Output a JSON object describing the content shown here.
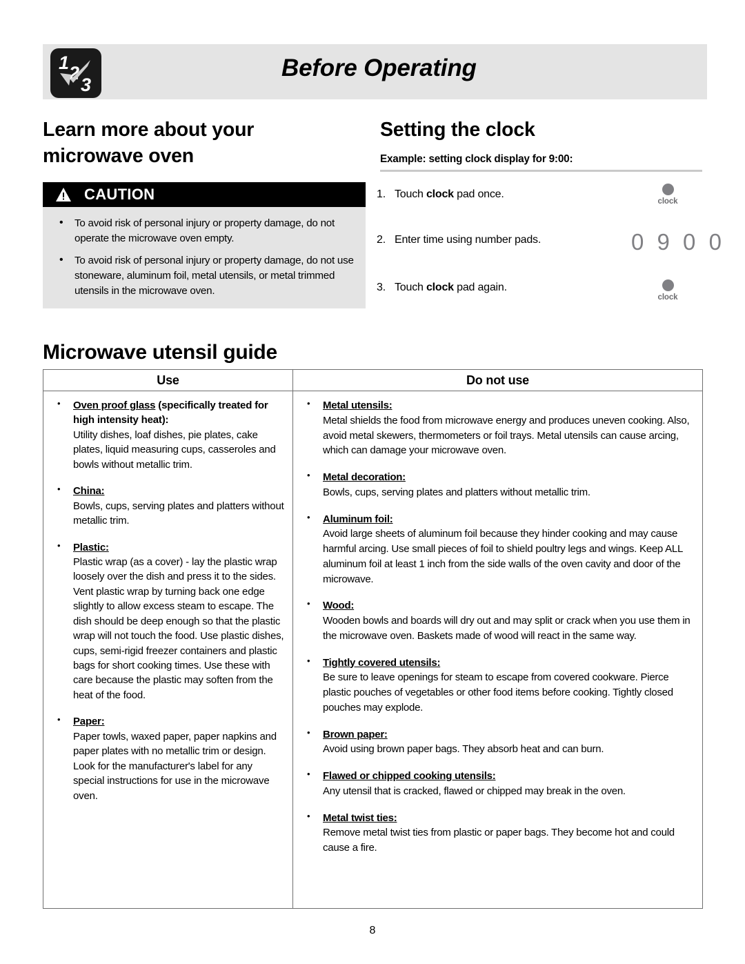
{
  "header": {
    "logo_icon": "123-checkmark-icon",
    "title": "Before Operating"
  },
  "left_column": {
    "heading": "Learn more about your microwave oven",
    "caution": {
      "icon": "warning-triangle-icon",
      "label": "CAUTION",
      "items": [
        "To avoid risk of personal injury or property damage, do not operate the microwave oven empty.",
        "To avoid risk of personal injury or property damage, do not use stoneware, aluminum foil, metal utensils, or metal trimmed utensils in the microwave oven."
      ]
    }
  },
  "clock_section": {
    "heading": "Setting the clock",
    "example_label": "Example: setting clock display for 9:00:",
    "steps": [
      {
        "num": "1.",
        "text_before": "Touch ",
        "bold": "clock",
        "text_after": " pad once."
      },
      {
        "num": "2.",
        "text_before": "Enter time using number pads.",
        "bold": "",
        "text_after": ""
      },
      {
        "num": "3.",
        "text_before": "Touch ",
        "bold": "clock",
        "text_after": " pad again."
      }
    ],
    "pad_icon_label_1": "clock",
    "pad_icon_label_2": "clock",
    "display_value": "0 9 0 0",
    "display_color": "#808084"
  },
  "guide": {
    "heading": "Microwave utensil guide",
    "columns": [
      "Use",
      "Do not use"
    ],
    "use_items": [
      {
        "term": "Oven proof glass",
        "term_rest": " (specifically treated for high intensity heat):",
        "desc": "Utility dishes, loaf dishes, pie plates, cake plates, liquid measuring cups, casseroles and bowls without metallic trim."
      },
      {
        "term": "China:",
        "term_rest": "",
        "desc": "Bowls, cups, serving plates and platters without metallic trim."
      },
      {
        "term": "Plastic:",
        "term_rest": "",
        "desc": "Plastic wrap (as a cover) - lay the plastic wrap loosely over the dish and press it to the sides. Vent plastic wrap by turning back one edge slightly to allow excess steam to escape. The dish should be deep enough so that the plastic wrap will not touch the food. Use plastic dishes, cups, semi-rigid freezer containers and plastic bags for short cooking times. Use these with care because the plastic may soften from the heat of the food."
      },
      {
        "term": "Paper:",
        "term_rest": "",
        "desc": "Paper towls, waxed paper, paper napkins and paper plates with no metallic trim or design. Look for the manufacturer's label for any special instructions for use in the microwave oven."
      }
    ],
    "do_not_use_items": [
      {
        "term": "Metal utensils:",
        "term_rest": "",
        "desc": "Metal shields the food from microwave energy and produces uneven cooking. Also, avoid metal skewers, thermometers or foil trays. Metal utensils can cause arcing, which can damage your microwave oven."
      },
      {
        "term": "Metal decoration:",
        "term_rest": "",
        "desc": "Bowls, cups, serving plates and platters without metallic trim."
      },
      {
        "term": "Aluminum foil:",
        "term_rest": "",
        "desc": "Avoid large sheets of aluminum foil because they hinder cooking and may cause harmful arcing. Use small pieces of foil to shield poultry legs and wings. Keep ALL aluminum foil at least 1 inch from the side walls of the oven cavity and door of the microwave."
      },
      {
        "term": "Wood:",
        "term_rest": "",
        "desc": "Wooden bowls and boards will dry out and may split or crack when you use them in the microwave oven. Baskets made of wood will react in the same way."
      },
      {
        "term": "Tightly covered utensils:",
        "term_rest": "",
        "desc": "Be sure to leave openings for steam to escape from covered cookware. Pierce plastic pouches of vegetables or other food items before cooking. Tightly closed pouches may explode."
      },
      {
        "term": "Brown paper:",
        "term_rest": "",
        "desc": "Avoid using brown paper bags. They absorb heat and can burn."
      },
      {
        "term": "Flawed or chipped cooking utensils:",
        "term_rest": "",
        "desc": "Any utensil that is cracked, flawed or chipped may break in the oven."
      },
      {
        "term": "Metal twist ties:",
        "term_rest": "",
        "desc": "Remove metal twist ties from plastic or paper bags. They become hot and could cause a fire."
      }
    ]
  },
  "page_number": "8",
  "colors": {
    "banner_bg": "#e4e4e4",
    "caution_bar_bg": "#000000",
    "caution_body_bg": "#e4e4e4",
    "table_border": "#6e6e6e",
    "display_gray": "#808084",
    "rule_gray": "#c9c9c9"
  }
}
